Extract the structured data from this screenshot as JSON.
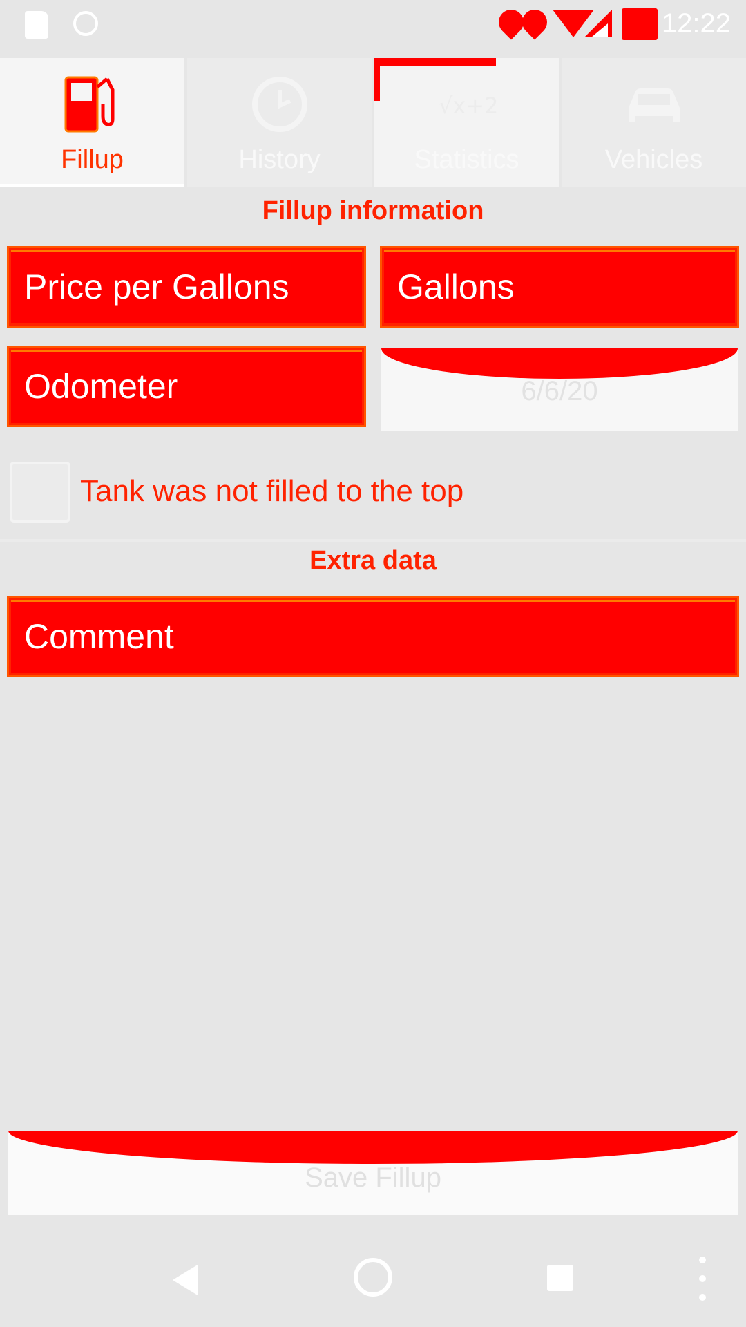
{
  "status_bar": {
    "time": "12:22",
    "icons": [
      "sd-card-icon",
      "sync-icon",
      "location-icon",
      "location-icon",
      "wifi-icon",
      "signal-icon",
      "battery-icon"
    ]
  },
  "tabs": [
    {
      "label": "Fillup",
      "icon": "fuel-pump-icon",
      "active": true
    },
    {
      "label": "History",
      "icon": "clock-icon",
      "active": false
    },
    {
      "label": "Statistics",
      "icon": "sqrt-formula-icon",
      "active": false
    },
    {
      "label": "Vehicles",
      "icon": "car-icon",
      "active": false
    }
  ],
  "fillup_section": {
    "title": "Fillup information",
    "price_placeholder": "Price per Gallons",
    "gallons_placeholder": "Gallons",
    "odometer_placeholder": "Odometer",
    "date_value": "6/6/20"
  },
  "checkbox": {
    "label": "Tank was not filled to the top",
    "checked": false
  },
  "extra_section": {
    "title": "Extra data",
    "comment_placeholder": "Comment"
  },
  "save_button": {
    "label": "Save Fillup"
  },
  "colors": {
    "accent": "#ff0000",
    "label_red": "#ff2200",
    "background": "#e6e6e6"
  }
}
